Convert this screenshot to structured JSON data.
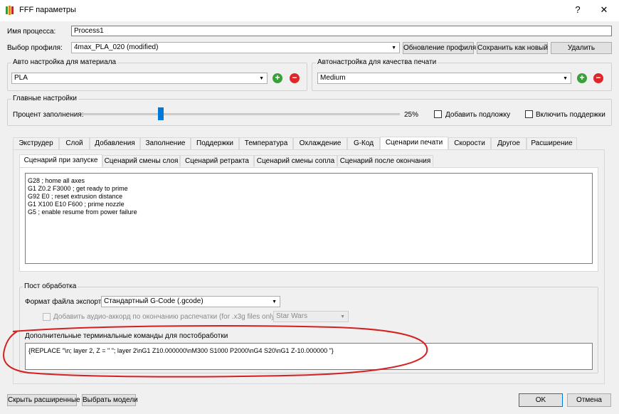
{
  "window": {
    "title": "FFF параметры",
    "help": "?",
    "close": "✕"
  },
  "process": {
    "label": "Имя процесса:",
    "value": "Process1"
  },
  "profile": {
    "label": "Выбор профиля:",
    "value": "4max_PLA_020 (modified)",
    "update_label": "Обновление профиля",
    "save_new_label": "Сохранить как новый",
    "delete_label": "Удалить"
  },
  "auto_material": {
    "title": "Авто настройка для материала",
    "value": "PLA"
  },
  "auto_quality": {
    "title": "Автонастройка для качества печати",
    "value": "Medium"
  },
  "main_settings": {
    "title": "Главные настройки",
    "infill_label": "Процент заполнения:",
    "infill_value": "25%",
    "infill_fraction": 0.25,
    "raft_label": "Добавить подложку",
    "support_label": "Включить поддержки"
  },
  "tabs": [
    "Экструдер",
    "Слой",
    "Добавления",
    "Заполнение",
    "Поддержки",
    "Температура",
    "Охлаждение",
    "G-Код",
    "Сценарии печати",
    "Скорости",
    "Другое",
    "Расширение"
  ],
  "active_tab": "Сценарии печати",
  "subtabs": [
    "Сценарий при запуске",
    "Сценарий смены слоя",
    "Сценарий ретракта",
    "Сценарий смены сопла",
    "Сценарий после окончания"
  ],
  "active_subtab": "Сценарий при запуске",
  "start_script": "G28 ; home all axes\nG1 Z0.2 F3000 ; get ready to prime\nG92 E0 ; reset extrusion distance\nG1 X100 E10 F600 ; prime nozzle\nG5 ; enable resume from power failure",
  "post": {
    "title": "Пост обработка",
    "format_label": "Формат файла экспорта",
    "format_value": "Стандартный G-Code (.gcode)",
    "audio_label": "Добавить аудио-аккорд по окончанию распечатки (for .x3g files only)",
    "audio_value": "Star Wars",
    "commands_label": "Дополнительные терминальные команды для постобработки",
    "commands_value": "{REPLACE \"\\n; layer 2, Z = \" \"; layer 2\\nG1 Z10.000000\\nM300 S1000 P2000\\nG4 S20\\nG1 Z-10.000000 \"}"
  },
  "footer": {
    "hide_advanced": "Скрыть расширенные",
    "select_models": "Выбрать модели",
    "ok": "OK",
    "cancel": "Отмена"
  },
  "colors": {
    "accent": "#0078d7",
    "annotation": "#d42020",
    "add": "#3aa13a",
    "delete": "#e0262b"
  },
  "icons": [
    "app-icon",
    "help-icon",
    "close-icon",
    "dropdown-arrow-icon",
    "add-icon",
    "remove-icon"
  ]
}
